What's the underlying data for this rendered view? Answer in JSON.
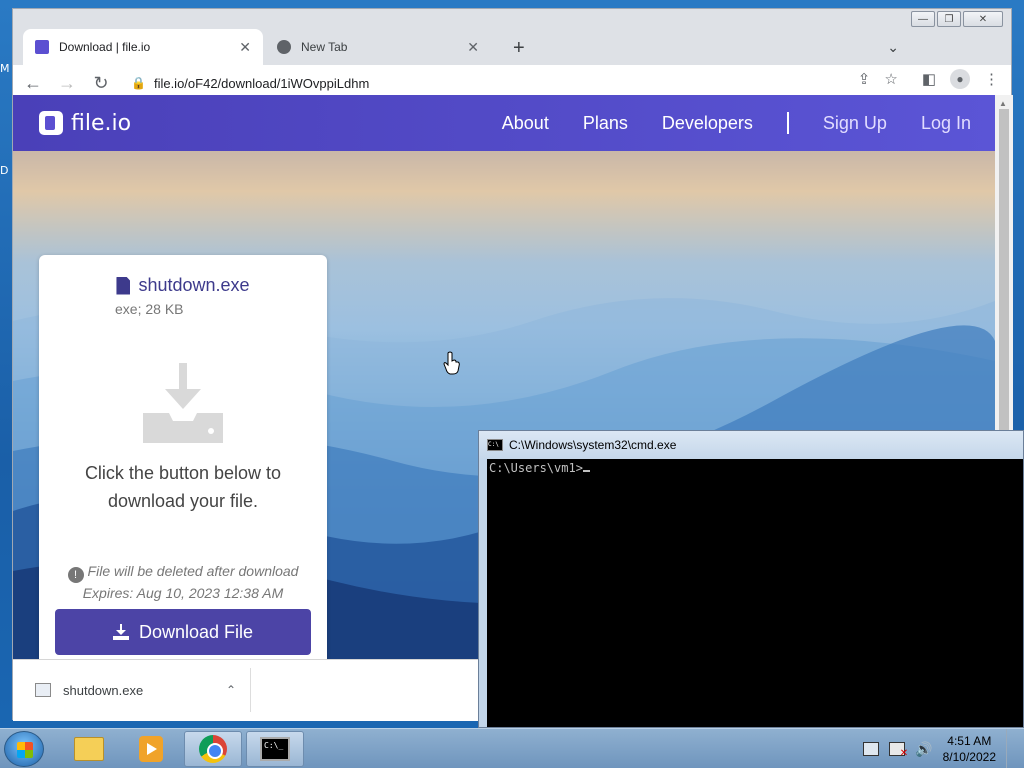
{
  "desktop": {
    "labels": [
      "M",
      "D"
    ]
  },
  "browser": {
    "window_controls": {
      "minimize": "—",
      "restore": "❐",
      "close": "✕"
    },
    "tabs": [
      {
        "title": "Download | file.io",
        "active": true,
        "close": "✕"
      },
      {
        "title": "New Tab",
        "active": false,
        "close": "✕"
      }
    ],
    "new_tab": "+",
    "tab_menu": "⌄",
    "nav": {
      "back": "←",
      "forward": "→",
      "reload": "↻"
    },
    "url": "file.io/oF42/download/1iWOvppiLdhm",
    "toolbar_icons": {
      "share": "⇪",
      "bookmark": "☆",
      "sidepanel": "◧",
      "profile": "👤",
      "menu": "⋮"
    }
  },
  "site": {
    "logo_text": "file.io",
    "nav_links": [
      "About",
      "Plans",
      "Developers",
      "Sign Up",
      "Log In"
    ],
    "card": {
      "file_name": "shutdown.exe",
      "file_meta": "exe; 28 KB",
      "message": "Click the button below to download your file.",
      "warning": "File will be deleted after download",
      "expires": "Expires: Aug 10, 2023 12:38 AM",
      "button": "Download File"
    }
  },
  "download_bar": {
    "item": "shutdown.exe",
    "chevron": "⌃"
  },
  "cmd": {
    "title": "C:\\Windows\\system32\\cmd.exe",
    "icon_text": "C:\\",
    "prompt": "C:\\Users\\vm1>"
  },
  "taskbar": {
    "time": "4:51 AM",
    "date": "8/10/2022",
    "cmd_icon_text": "C:\\_"
  },
  "colors": {
    "brand": "#5b55d6",
    "button": "#4c44a6",
    "file_name": "#3d3a8c"
  }
}
